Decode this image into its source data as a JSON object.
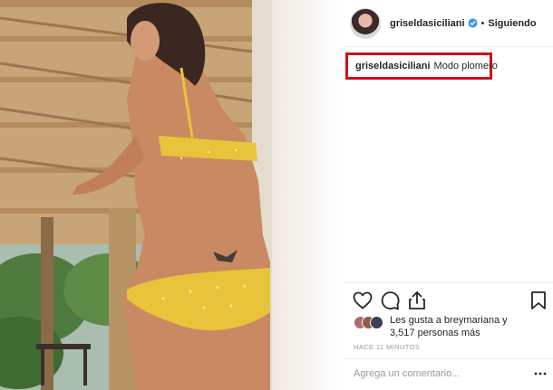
{
  "header": {
    "username": "griseldasiciliani",
    "separator": "•",
    "follow_state": "Siguiendo"
  },
  "caption": {
    "username": "griseldasiciliani",
    "text": "Modo plomero"
  },
  "icons": {
    "like": "heart-icon",
    "comment": "comment-icon",
    "share": "share-icon",
    "save": "bookmark-icon",
    "verified": "verified-badge-icon",
    "more": "more-options-icon"
  },
  "likes": {
    "line1": "Les gusta a breymariana y",
    "line2": "3,517 personas más"
  },
  "timestamp": "HACE 11 MINUTOS",
  "comment": {
    "placeholder": "Agrega un comentario..."
  },
  "colors": {
    "caption_highlight": "#d0101a",
    "verified": "#3897f0",
    "bikini": "#e8c43a"
  }
}
